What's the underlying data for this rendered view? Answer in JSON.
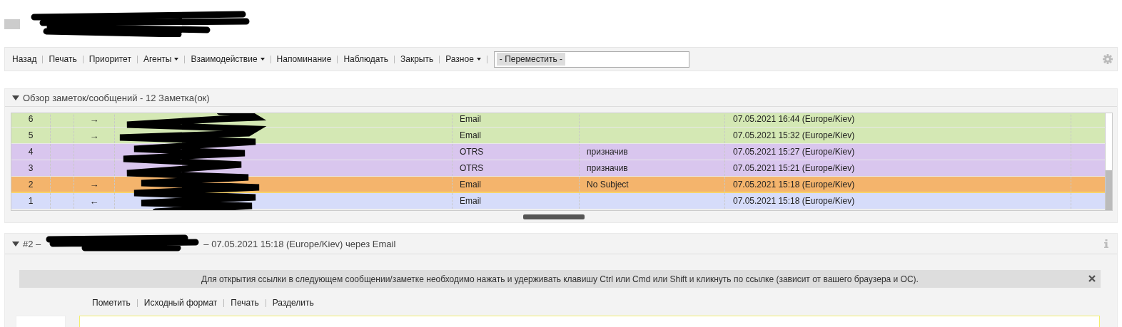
{
  "toolbar": {
    "items": [
      {
        "label": "Назад",
        "dropdown": false
      },
      {
        "label": "Печать",
        "dropdown": false
      },
      {
        "label": "Приоритет",
        "dropdown": false
      },
      {
        "label": "Агенты",
        "dropdown": true
      },
      {
        "label": "Взаимодействие",
        "dropdown": true
      },
      {
        "label": "Напоминание",
        "dropdown": false
      },
      {
        "label": "Наблюдать",
        "dropdown": false
      },
      {
        "label": "Закрыть",
        "dropdown": false
      },
      {
        "label": "Разное",
        "dropdown": true
      }
    ],
    "move_select": {
      "value": "- Переместить -"
    }
  },
  "overview": {
    "title": "Обзор заметок/сообщений - 12 Заметка(ок)",
    "expanded": true,
    "rows": [
      {
        "number": "6",
        "direction": "→",
        "type": "Email",
        "date": "07.05.2021 16:44 (Europe/Kiev)",
        "color": "#d4e8b4",
        "selected": false
      },
      {
        "number": "5",
        "direction": "→",
        "type": "Email",
        "date": "07.05.2021 15:32 (Europe/Kiev)",
        "color": "#d4e8b4",
        "selected": false
      },
      {
        "number": "4",
        "type": "OTRS",
        "subject": "призначив",
        "date": "07.05.2021 15:27 (Europe/Kiev)",
        "color": "#d9c6ee",
        "selected": false
      },
      {
        "number": "3",
        "type": "OTRS",
        "subject": "призначив",
        "date": "07.05.2021 15:21 (Europe/Kiev)",
        "color": "#d9c6ee",
        "selected": false
      },
      {
        "number": "2",
        "direction": "→",
        "type": "Email",
        "subject": "No Subject",
        "date": "07.05.2021 15:18 (Europe/Kiev)",
        "color": "#f4b46c",
        "selected": true
      },
      {
        "number": "1",
        "direction": "←",
        "type": "Email",
        "date": "07.05.2021 15:18 (Europe/Kiev)",
        "color": "#d6dcfa",
        "selected": false
      }
    ]
  },
  "article": {
    "title_prefix": "#2 –",
    "title_suffix": "– 07.05.2021 15:18 (Europe/Kiev) через Email",
    "expanded": true,
    "notice": "Для открытия ссылки в следующем сообщении/заметке необходимо нажать и удерживать клавишу Ctrl или Cmd или Shift и кликнуть по ссылке (зависит от вашего браузера и ОС).",
    "actions": [
      "Пометить",
      "Исходный формат",
      "Печать",
      "Разделить"
    ]
  }
}
